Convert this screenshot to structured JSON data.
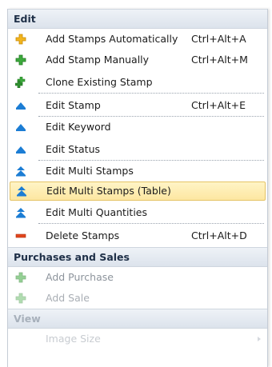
{
  "sections": {
    "edit": {
      "title": "Edit",
      "items": {
        "add_auto": {
          "label": "Add Stamps Automatically",
          "shortcut": "Ctrl+Alt+A",
          "icon": "yellow-plus-icon"
        },
        "add_manual": {
          "label": "Add Stamp Manually",
          "shortcut": "Ctrl+Alt+M",
          "icon": "green-plus-icon"
        },
        "clone": {
          "label": "Clone Existing Stamp",
          "icon": "clone-plus-icon"
        },
        "edit_stamp": {
          "label": "Edit Stamp",
          "shortcut": "Ctrl+Alt+E",
          "icon": "blue-triangle-icon"
        },
        "edit_keyword": {
          "label": "Edit Keyword",
          "icon": "blue-triangle-icon"
        },
        "edit_status": {
          "label": "Edit Status",
          "icon": "blue-triangle-icon"
        },
        "edit_multi": {
          "label": "Edit Multi Stamps",
          "icon": "double-triangle-icon"
        },
        "edit_multi_table": {
          "label": "Edit Multi Stamps (Table)",
          "icon": "double-triangle-icon"
        },
        "edit_multi_qty": {
          "label": "Edit Multi Quantities",
          "icon": "double-triangle-icon"
        },
        "delete": {
          "label": "Delete Stamps",
          "shortcut": "Ctrl+Alt+D",
          "icon": "red-minus-icon"
        }
      }
    },
    "purchases": {
      "title": "Purchases and Sales",
      "items": {
        "add_purchase": {
          "label": "Add Purchase",
          "icon": "green-plus-icon"
        },
        "add_sale": {
          "label": "Add Sale",
          "icon": "green-plus-icon"
        }
      }
    },
    "view": {
      "title": "View",
      "items": {
        "image_size": {
          "label": "Image Size",
          "icon": "submenu-arrow-icon"
        }
      }
    }
  },
  "colors": {
    "highlight_fill": "#fde7a1",
    "highlight_border": "#e5c365",
    "header_text": "#1e2f47",
    "header_bg": "#dce3ec",
    "icon_blue": "#1c7dd4",
    "icon_green": "#3daa3d",
    "icon_yellow": "#f2b51f",
    "icon_red": "#e2461d"
  }
}
